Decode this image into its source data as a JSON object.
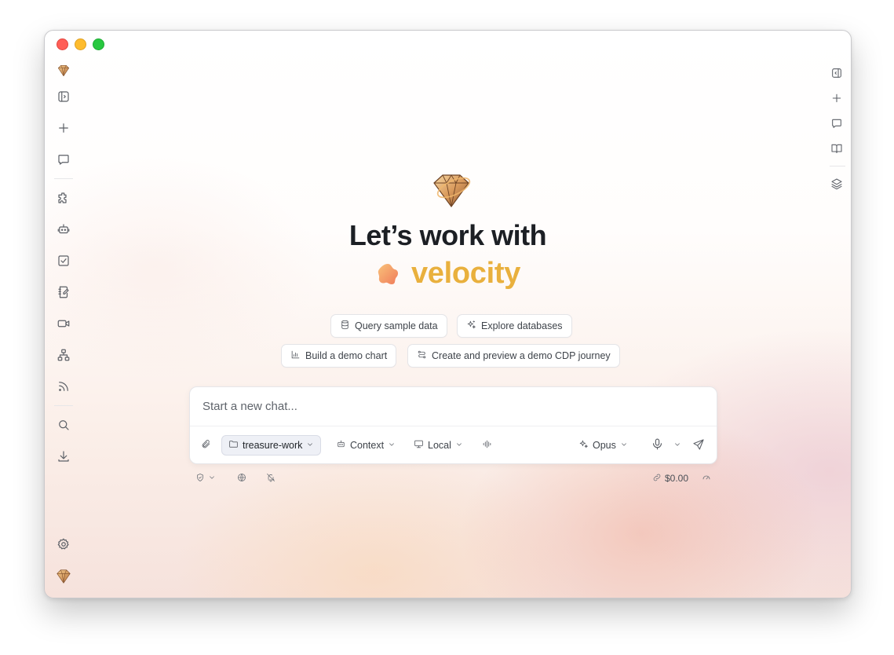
{
  "window": {
    "controls": [
      "close",
      "minimize",
      "maximize"
    ]
  },
  "left_sidebar": {
    "items": [
      {
        "name": "app-logo-icon"
      },
      {
        "name": "sidebar-toggle-icon"
      },
      {
        "name": "new-chat-icon"
      },
      {
        "name": "chats-icon"
      },
      {
        "name": "plugins-icon"
      },
      {
        "name": "agents-icon"
      },
      {
        "name": "tasks-icon"
      },
      {
        "name": "notebook-icon"
      },
      {
        "name": "video-icon"
      },
      {
        "name": "hierarchy-icon"
      },
      {
        "name": "feeds-icon"
      },
      {
        "name": "search-icon"
      },
      {
        "name": "download-icon"
      },
      {
        "name": "settings-icon"
      },
      {
        "name": "profile-logo-icon"
      }
    ]
  },
  "right_sidebar": {
    "items": [
      {
        "name": "panel-toggle-icon"
      },
      {
        "name": "add-icon"
      },
      {
        "name": "chat-icon"
      },
      {
        "name": "book-icon"
      },
      {
        "name": "layers-icon"
      }
    ]
  },
  "hero": {
    "title": "Let’s work with",
    "brand": "velocity",
    "brand_color": "#e9b03d"
  },
  "suggestions": [
    {
      "label": "Query sample data",
      "icon": "database-icon"
    },
    {
      "label": "Explore databases",
      "icon": "sparkles-icon"
    },
    {
      "label": "Build a demo chart",
      "icon": "bar-chart-icon"
    },
    {
      "label": "Create and preview a demo CDP journey",
      "icon": "route-icon"
    }
  ],
  "composer": {
    "placeholder": "Start a new chat...",
    "value": "",
    "workspace": "treasure-work",
    "context_label": "Context",
    "local_label": "Local",
    "model_label": "Opus"
  },
  "status_bar": {
    "cost": "$0.00"
  }
}
